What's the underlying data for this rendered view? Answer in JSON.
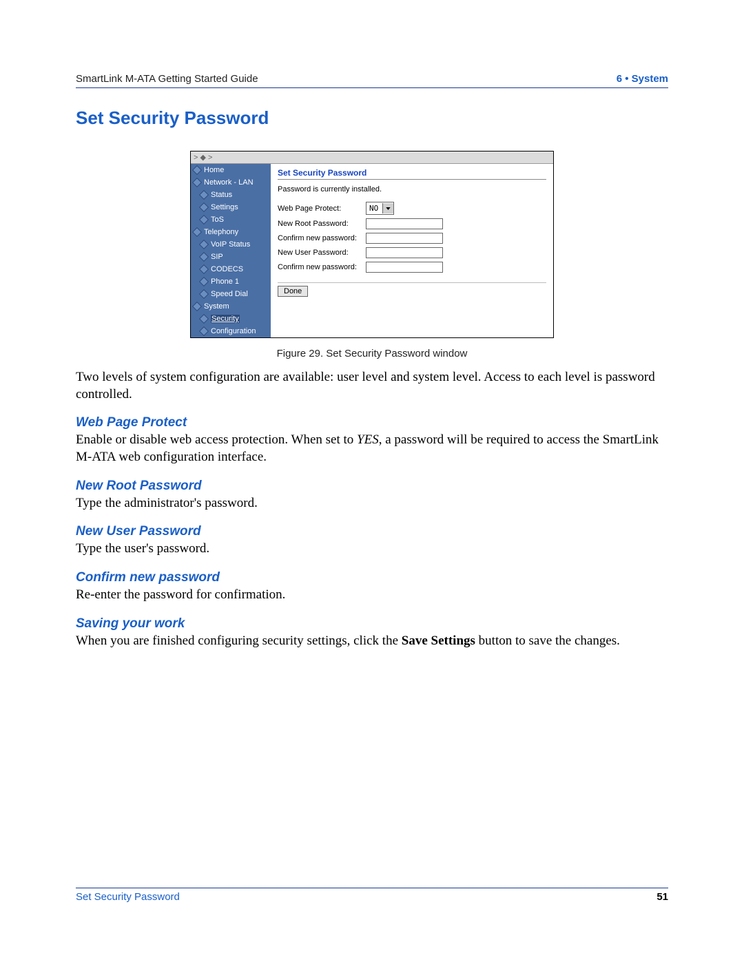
{
  "header": {
    "left": "SmartLink M-ATA Getting Started Guide",
    "right": "6 • System"
  },
  "title": "Set Security Password",
  "figure": {
    "caption": "Figure 29. Set Security Password window"
  },
  "win": {
    "breadcrumb_arrows": "> ◆ >",
    "sidebar": [
      {
        "label": "Home",
        "depth": 0
      },
      {
        "label": "Network - LAN",
        "depth": 0
      },
      {
        "label": "Status",
        "depth": 1
      },
      {
        "label": "Settings",
        "depth": 1
      },
      {
        "label": "ToS",
        "depth": 1
      },
      {
        "label": "Telephony",
        "depth": 0
      },
      {
        "label": "VoIP Status",
        "depth": 1
      },
      {
        "label": "SIP",
        "depth": 1
      },
      {
        "label": "CODECS",
        "depth": 1
      },
      {
        "label": "Phone 1",
        "depth": 1
      },
      {
        "label": "Speed Dial",
        "depth": 1
      },
      {
        "label": "System",
        "depth": 0
      },
      {
        "label": "Security",
        "depth": 1,
        "current": true
      },
      {
        "label": "Configuration",
        "depth": 1
      }
    ],
    "panel": {
      "title": "Set Security Password",
      "status": "Password is currently installed.",
      "rows": {
        "web_page_protect_label": "Web Page Protect:",
        "web_page_protect_value": "NO",
        "new_root_pw_label": "New Root Password:",
        "confirm_root_label": "Confirm new password:",
        "new_user_pw_label": "New User Password:",
        "confirm_user_label": "Confirm new password:"
      },
      "done_label": "Done"
    }
  },
  "paragraphs": {
    "intro": "Two levels of system configuration are available: user level and system level. Access to each level is password controlled.",
    "wpp_heading": "Web Page Protect",
    "wpp_text_1": "Enable or disable web access protection. When set to ",
    "wpp_text_yes": "YES",
    "wpp_text_2": ", a password will be required to access the SmartLink M-ATA web configuration interface.",
    "nrp_heading": "New Root Password",
    "nrp_text": "Type the administrator's password.",
    "nup_heading": "New User Password",
    "nup_text": "Type the user's password.",
    "cnp_heading": "Confirm new password",
    "cnp_text": "Re-enter the password for confirmation.",
    "syw_heading": "Saving your work",
    "syw_text_1": "When you are finished configuring security settings, click the ",
    "syw_bold": "Save Settings",
    "syw_text_2": " button to save the changes."
  },
  "footer": {
    "left": "Set Security Password",
    "right": "51"
  }
}
